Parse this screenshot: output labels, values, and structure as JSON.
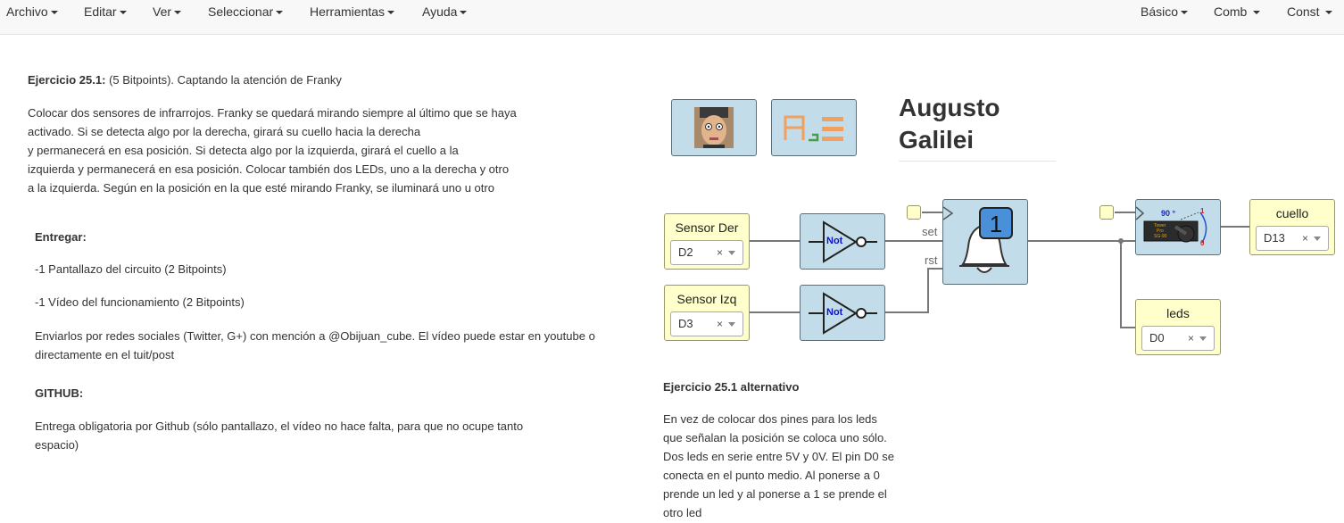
{
  "menu": {
    "left": [
      "Archivo",
      "Editar",
      "Ver",
      "Seleccionar",
      "Herramientas",
      "Ayuda"
    ],
    "right": [
      "Básico",
      "Comb",
      "Const"
    ]
  },
  "left": {
    "ex_title_bold": "Ejercicio 25.1:",
    "ex_title_rest": " (5 Bitpoints). Captando la atención de Franky",
    "desc": [
      "Colocar dos sensores de infrarrojos. Franky se quedará mirando siempre al último que se haya",
      "activado. Si se detecta algo por la derecha, girará su cuello hacia la derecha",
      "y permanecerá en esa posición. Si detecta algo por la izquierda, girará el cuello a la",
      "izquierda y permanecerá en esa posición. Colocar también dos LEDs, uno a la derecha y otro",
      "a la izquierda. Según en la posición en la que esté mirando Franky, se iluminará uno u otro"
    ],
    "entregar": "Entregar:",
    "item1": "-1 Pantallazo del circuito (2 Bitpoints)",
    "item2": "-1 Vídeo del funcionamiento (2 Bitpoints)",
    "enviar": [
      "Enviarlos por redes sociales (Twitter, G+) con mención a @Obijuan_cube. El vídeo puede estar en youtube o",
      "directamente en el tuit/post"
    ],
    "github": "GITHUB:",
    "github_text": [
      "Entrega obligatoria por Github (sólo pantallazo, el vídeo no hace falta, para que no ocupe tanto",
      "espacio)"
    ]
  },
  "author": {
    "first": "Augusto",
    "last": "Galilei"
  },
  "circuit": {
    "sensor_der": {
      "label": "Sensor Der",
      "value": "D2"
    },
    "sensor_izq": {
      "label": "Sensor Izq",
      "value": "D3"
    },
    "not_label": "Not",
    "flipflop_value": "1",
    "set_label": "set",
    "rst_label": "rst",
    "servo_angle": "90 °",
    "servo_one": "1",
    "servo_zero": "0",
    "servo_text": [
      "Tower",
      "Pro",
      "SG-90"
    ],
    "cuello": {
      "label": "cuello",
      "value": "D13"
    },
    "leds": {
      "label": "leds",
      "value": "D0"
    },
    "clear_glyph": "×"
  },
  "alt": {
    "title": "Ejercicio 25.1 alternativo",
    "text": [
      "En vez de colocar dos pines para los leds",
      "que señalan la posición se coloca uno sólo.",
      "Dos leds en serie entre 5V y 0V. El pin D0 se",
      "conecta en el punto medio. Al ponerse a 0",
      "prende un led y al ponerse a 1 se prende el",
      "otro led"
    ]
  },
  "colors": {
    "block": "#c2dde9",
    "io": "#ffffcc",
    "flipflop_display": "#4a90d9"
  }
}
